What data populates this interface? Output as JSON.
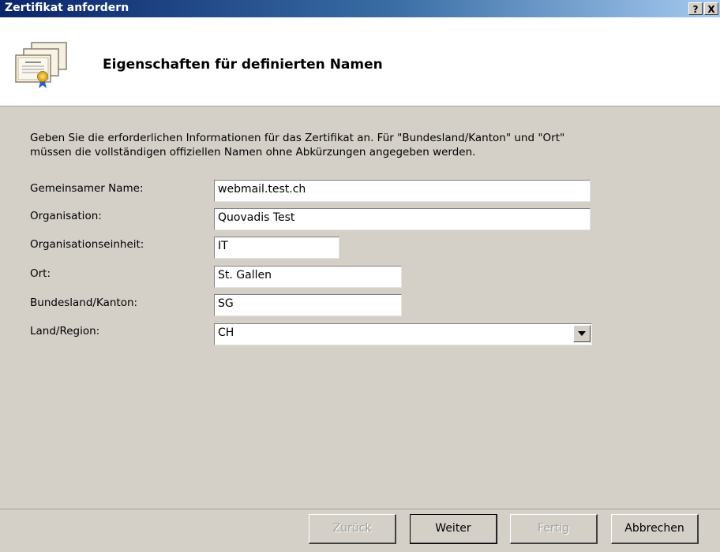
{
  "window": {
    "title": "Zertifikat anfordern",
    "help_label": "?",
    "close_label": "X"
  },
  "header": {
    "title": "Eigenschaften für definierten Namen",
    "icon": "certificate-icon"
  },
  "intro": {
    "line1": "Geben Sie die erforderlichen Informationen für das Zertifikat an. Für \"Bundesland/Kanton\" und \"Ort\"",
    "line2": "müssen die vollständigen offiziellen Namen ohne Abkürzungen angegeben werden."
  },
  "fields": {
    "common_name": {
      "label": "Gemeinsamer Name:",
      "value": "webmail.test.ch"
    },
    "organization": {
      "label": "Organisation:",
      "value": "Quovadis Test"
    },
    "org_unit": {
      "label": "Organisationseinheit:",
      "value": "IT"
    },
    "city": {
      "label": "Ort:",
      "value": "St. Gallen"
    },
    "state": {
      "label": "Bundesland/Kanton:",
      "value": "SG"
    },
    "country": {
      "label": "Land/Region:",
      "value": "CH"
    }
  },
  "buttons": {
    "back": "Zurück",
    "next": "Weiter",
    "finish": "Fertig",
    "cancel": "Abbrechen"
  }
}
